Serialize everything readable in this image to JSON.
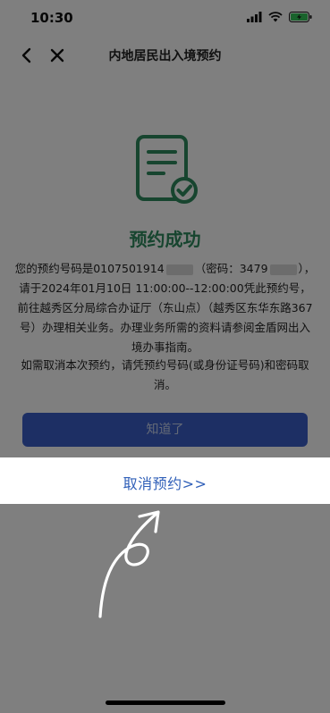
{
  "status_bar": {
    "time": "10:30"
  },
  "nav": {
    "title": "内地居民出入境预约",
    "back_icon": "chevron-left-icon",
    "close_icon": "close-icon"
  },
  "result": {
    "title": "预约成功",
    "line1_prefix": "您的预约号码是0107501914",
    "line1_code_label": "（密码：3479",
    "line1_suffix": "），请于2024年01月10日 11:00:00--12:00:00凭此预约号， 前往越秀区分局综合办证厅（东山点）（越秀区东华东路367号）办理相关业务。办理业务所需的资料请参阅金盾网出入境办事指南。",
    "cancel_note": "如需取消本次预约，请凭预约号码(或身份证号码)和密码取消。",
    "ok_button": "知道了",
    "cancel_link": "取消预约>>"
  },
  "colors": {
    "accent_green": "#2e8b5e",
    "button_blue": "#3a5fc8",
    "link_blue": "#2f5fb8"
  }
}
